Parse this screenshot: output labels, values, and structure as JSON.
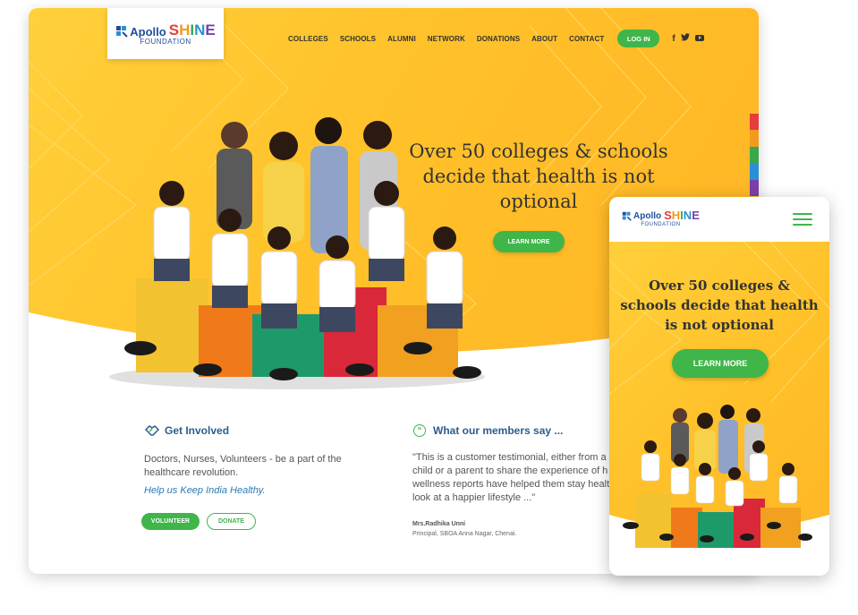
{
  "brand": {
    "apollo": "Apollo",
    "shine_letters": [
      "S",
      "H",
      "I",
      "N",
      "E"
    ],
    "foundation": "FOUNDATION"
  },
  "nav": {
    "items": [
      "COLLEGES",
      "SCHOOLS",
      "ALUMNI",
      "NETWORK",
      "DONATIONS",
      "ABOUT",
      "CONTACT"
    ],
    "login": "LOG IN",
    "social": [
      "facebook-icon",
      "twitter-icon",
      "youtube-icon"
    ]
  },
  "hero": {
    "title": "Over 50 colleges & schools decide that health is not optional",
    "cta": "LEARN MORE"
  },
  "get_involved": {
    "title": "Get Involved",
    "text": "Doctors, Nurses, Volunteers - be a part of the healthcare revolution.",
    "link": "Help us Keep India Healthy.",
    "volunteer": "VOLUNTEER",
    "donate": "DONATE"
  },
  "members": {
    "title": "What our members say ...",
    "quote": "\"This is a customer testimonial, either from a s a child or a parent to share the experience of h wellness reports have helped them stay health look at a happier lifestyle ...\"",
    "author": "Mrs.Radhika Unni",
    "role": "Principal, SBOA Anna Nagar, Chenai."
  },
  "mobile": {
    "title": "Over 50 colleges & schools decide that health is not optional",
    "cta": "LEARN MORE"
  },
  "colors": {
    "accent_green": "#3fb54a",
    "hero_yellow": "#ffc12a",
    "heading_blue": "#2a5d8c",
    "rainbow": [
      "#e63c3c",
      "#f39a1c",
      "#3aa84a",
      "#2b8fd6",
      "#7a3fa8"
    ]
  }
}
